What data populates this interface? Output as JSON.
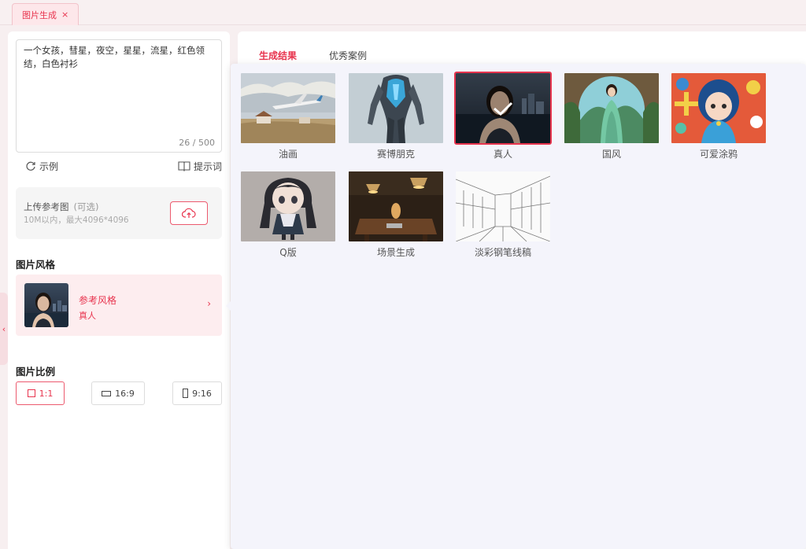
{
  "tabs": [
    {
      "label": "图片生成",
      "close": "×"
    }
  ],
  "prompt": {
    "value": "一个女孩，彗星，夜空，星星，流星，红色领结，白色衬衫",
    "count": "26 / 500"
  },
  "tools": {
    "example": "示例",
    "hints": "提示词"
  },
  "upload": {
    "title": "上传参考图",
    "optional": "(可选)",
    "subtitle": "10M以内，最大4096*4096"
  },
  "style_section": {
    "title": "图片风格",
    "card_title": "参考风格",
    "card_value": "真人",
    "arrow": "›"
  },
  "ratio_section": {
    "title": "图片比例",
    "options": [
      {
        "label": "1:1",
        "active": true
      },
      {
        "label": "16:9",
        "active": false
      },
      {
        "label": "9:16",
        "active": false
      }
    ]
  },
  "right_tabs": [
    {
      "label": "生成结果",
      "active": true
    },
    {
      "label": "优秀案例",
      "active": false
    }
  ],
  "styles": [
    {
      "label": "油画",
      "selected": false
    },
    {
      "label": "赛博朋克",
      "selected": false
    },
    {
      "label": "真人",
      "selected": true
    },
    {
      "label": "国风",
      "selected": false
    },
    {
      "label": "可爱涂鸦",
      "selected": false
    },
    {
      "label": "Q版",
      "selected": false
    },
    {
      "label": "场景生成",
      "selected": false
    },
    {
      "label": "淡彩钢笔线稿",
      "selected": false
    }
  ],
  "colors": {
    "accent": "#e8344e",
    "popup_bg": "#f4f4fb"
  }
}
